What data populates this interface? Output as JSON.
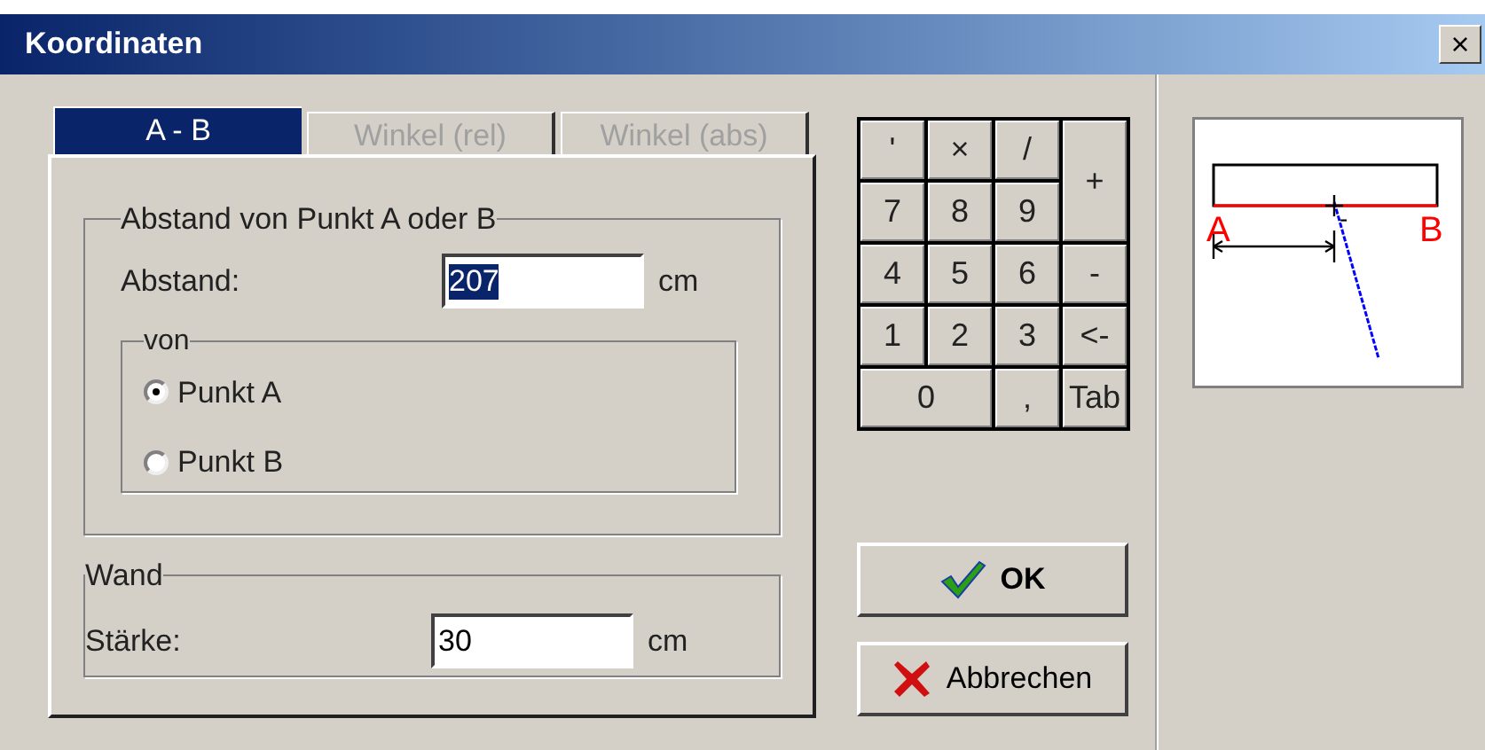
{
  "window": {
    "title": "Koordinaten",
    "close": "×"
  },
  "tabs": [
    {
      "label": "A - B",
      "selected": true,
      "disabled": false
    },
    {
      "label": "Winkel (rel)",
      "selected": false,
      "disabled": true
    },
    {
      "label": "Winkel (abs)",
      "selected": false,
      "disabled": true
    }
  ],
  "distance_group": {
    "legend": "Abstand von Punkt A oder B",
    "label": "Abstand:",
    "value": "207",
    "unit": "cm",
    "from_group": {
      "legend": "von",
      "options": [
        {
          "label": "Punkt A",
          "selected": true
        },
        {
          "label": "Punkt B",
          "selected": false
        }
      ]
    }
  },
  "wall_group": {
    "legend": "Wand",
    "label": "Stärke:",
    "value": "30",
    "unit": "cm"
  },
  "keypad": [
    {
      "label": "'",
      "kind": "normal"
    },
    {
      "label": "×",
      "kind": "normal"
    },
    {
      "label": "/",
      "kind": "normal"
    },
    {
      "label": "+",
      "kind": "tall"
    },
    {
      "label": "7",
      "kind": "normal"
    },
    {
      "label": "8",
      "kind": "normal"
    },
    {
      "label": "9",
      "kind": "normal"
    },
    {
      "label": "4",
      "kind": "normal"
    },
    {
      "label": "5",
      "kind": "normal"
    },
    {
      "label": "6",
      "kind": "normal"
    },
    {
      "label": "-",
      "kind": "normal"
    },
    {
      "label": "1",
      "kind": "normal"
    },
    {
      "label": "2",
      "kind": "normal"
    },
    {
      "label": "3",
      "kind": "normal"
    },
    {
      "label": "<-",
      "kind": "normal"
    },
    {
      "label": "0",
      "kind": "wide"
    },
    {
      "label": ",",
      "kind": "normal"
    },
    {
      "label": "Tab",
      "kind": "normal"
    }
  ],
  "buttons": [
    {
      "label": "OK",
      "kind": "ok"
    },
    {
      "label": "Abbrechen",
      "kind": "cancel"
    }
  ],
  "preview": {
    "label_a": "A",
    "label_b": "B",
    "marker": "-"
  }
}
